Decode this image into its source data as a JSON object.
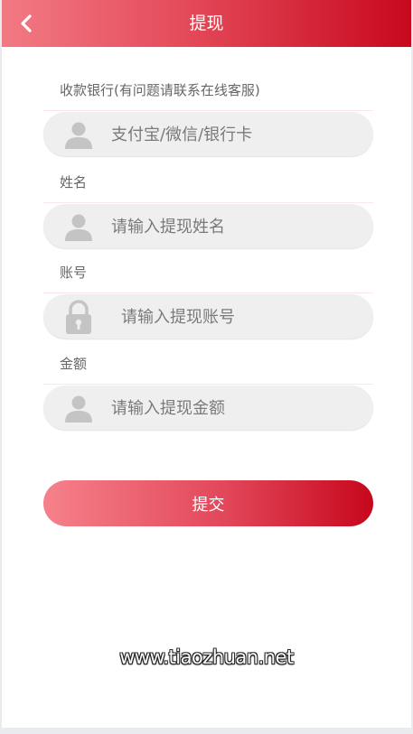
{
  "header": {
    "title": "提现",
    "back_icon": "chevron-left-icon"
  },
  "colors": {
    "accent_start": "#f27a84",
    "accent_end": "#c8081d"
  },
  "form": {
    "bank": {
      "label": "收款银行(有问题请联系在线客服)",
      "placeholder": "支付宝/微信/银行卡",
      "icon": "user-icon"
    },
    "name": {
      "label": "姓名",
      "placeholder": "请输入提现姓名",
      "icon": "user-icon"
    },
    "account": {
      "label": "账号",
      "placeholder": "请输入提现账号",
      "icon": "lock-icon"
    },
    "amount": {
      "label": "金额",
      "placeholder": "请输入提现金额",
      "icon": "user-icon"
    },
    "submit_label": "提交"
  },
  "watermark": "www.tiaozhuan.net"
}
